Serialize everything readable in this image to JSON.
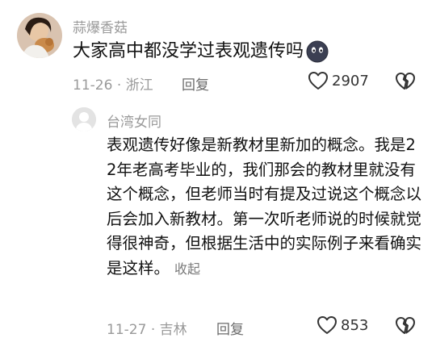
{
  "comment": {
    "author": "蒜爆香菇",
    "text": "大家高中都没学过表观遗传吗",
    "emoji_icon": "dark-face-emoji",
    "date": "11-26",
    "location": "浙江",
    "separator": "·",
    "reply_label": "回复",
    "likes": "2907"
  },
  "reply": {
    "author": "台湾女同",
    "text": "表观遗传好像是新教材里新加的概念。我是22年老高考毕业的，我们那会的教材里就没有这个概念，但老师当时有提及过说这个概念以后会加入新教材。第一次听老师说的时候就觉得很神奇，但根据生活中的实际例子来看确实是这样。",
    "collapse_label": "收起",
    "date": "11-27",
    "location": "吉林",
    "separator": "·",
    "reply_label": "回复",
    "likes": "853"
  },
  "colors": {
    "meta_gray": "#9a9a9a",
    "text_dark": "#111111"
  }
}
